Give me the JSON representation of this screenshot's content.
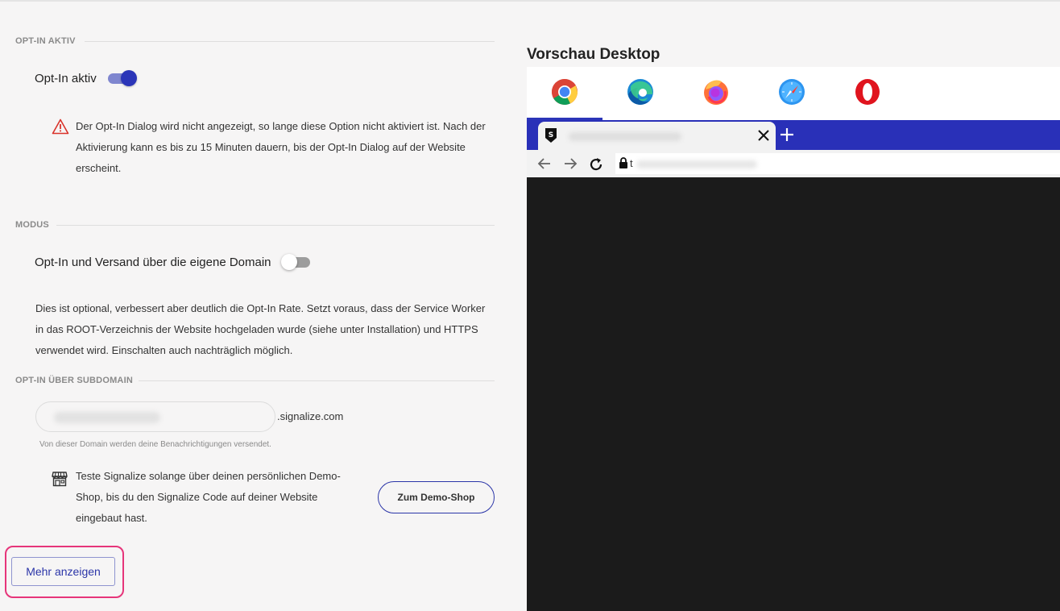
{
  "left": {
    "optin_section_label": "OPT-IN AKTIV",
    "optin_toggle_label": "Opt-In aktiv",
    "optin_toggle_state": "on",
    "warning_text": "Der Opt-In Dialog wird nicht angezeigt, so lange diese Option nicht aktiviert ist. Nach der Aktivierung kann es bis zu 15 Minuten dauern, bis der Opt-In Dialog auf der Website erscheint.",
    "mode_section_label": "MODUS",
    "mode_toggle_label": "Opt-In und Versand über die eigene Domain",
    "mode_toggle_state": "off",
    "mode_description": "Dies ist optional, verbessert aber deutlich die Opt-In Rate. Setzt voraus, dass der Service Worker in das ROOT-Verzeichnis der Website hochgeladen wurde (siehe unter Installation) und HTTPS verwendet wird. Einschalten auch nachträglich möglich.",
    "subdomain_section_label": "OPT-IN ÜBER SUBDOMAIN",
    "subdomain_suffix": ".signalize.com",
    "subdomain_hint": "Von dieser Domain werden deine Benachrichtigungen versendet.",
    "demo_text": "Teste Signalize solange über deinen persönlichen Demo-Shop, bis du den Signalize Code auf deiner Website eingebaut hast.",
    "demo_button_label": "Zum Demo-Shop",
    "more_button_label": "Mehr anzeigen"
  },
  "preview": {
    "title": "Vorschau Desktop",
    "browsers": [
      "chrome-icon",
      "edge-icon",
      "firefox-icon",
      "safari-icon",
      "opera-icon"
    ],
    "active_browser": "chrome-icon",
    "address_prefix": "t"
  },
  "colors": {
    "accent": "#2b35b8",
    "highlight": "#e6357a",
    "warning": "#d9332b",
    "preview_bg": "#1b1b1b"
  }
}
